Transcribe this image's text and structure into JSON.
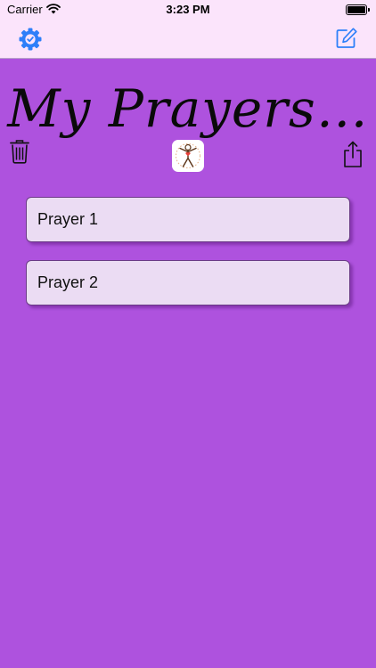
{
  "status_bar": {
    "carrier": "Carrier",
    "time": "3:23 PM"
  },
  "nav": {
    "left_icon": "gear-check-icon",
    "right_icon": "compose-icon"
  },
  "main": {
    "title": "My Prayers…",
    "toolbar": {
      "left_icon": "trash-icon",
      "center_icon": "app-logo",
      "right_icon": "share-icon"
    },
    "prayers": [
      {
        "label": "Prayer 1"
      },
      {
        "label": "Prayer 2"
      }
    ]
  },
  "colors": {
    "background": "#ae52de",
    "bar": "#fbe4fb",
    "accent": "#2d7ff9",
    "row": "#ebdcf3"
  }
}
